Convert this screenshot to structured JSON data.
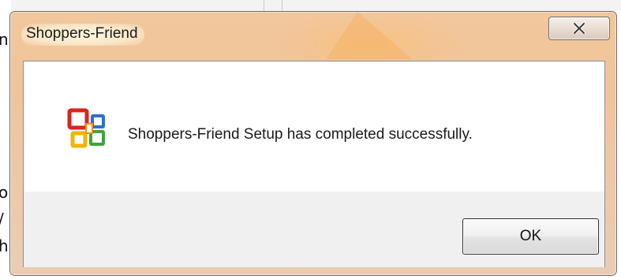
{
  "background_app": {
    "edge_chars": [
      "n",
      "o",
      "/",
      "h"
    ]
  },
  "dialog": {
    "title": "Shoppers-Friend",
    "message": "Shoppers-Friend Setup has completed successfully.",
    "ok_label": "OK",
    "icon": "office-setup-icon",
    "close_icon": "close-x-icon"
  },
  "colors": {
    "frame": "#efc49a",
    "client_bg": "#ffffff",
    "button_area_bg": "#f0f0f0",
    "text": "#1a1a1a"
  }
}
